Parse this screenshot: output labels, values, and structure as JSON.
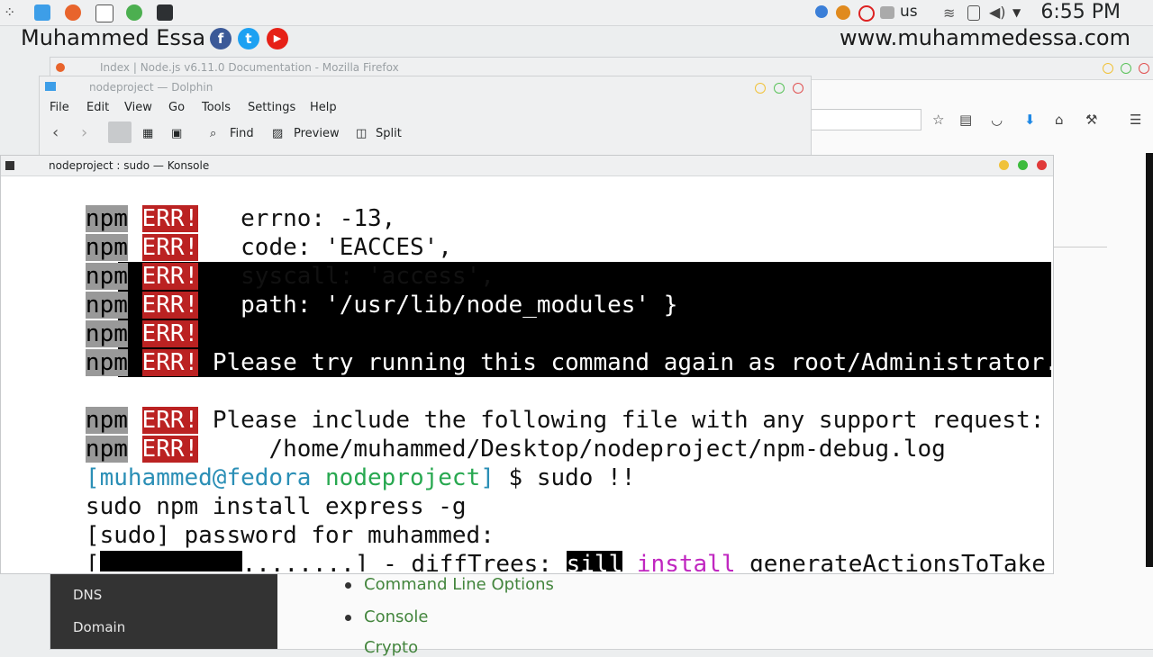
{
  "panel": {
    "keyboard_layout": "us",
    "clock": "6:55 PM",
    "colors": {
      "background": "#eff0f1"
    }
  },
  "watermark": {
    "name": "Muhammed Essa",
    "site": "www.muhammedessa.com",
    "social": [
      "f",
      "t",
      "▶"
    ]
  },
  "firefox": {
    "title": "Index | Node.js v6.11.0 Documentation - Mozilla Firefox",
    "sidebar_items": [
      "DNS",
      "Domain"
    ],
    "doc_links": [
      "Command Line Options",
      "Console",
      "Crypto"
    ]
  },
  "dolphin": {
    "title": "nodeproject — Dolphin",
    "menu": [
      "File",
      "Edit",
      "View",
      "Go",
      "Tools",
      "Settings",
      "Help"
    ],
    "toolbar": {
      "find": "Find",
      "preview": "Preview",
      "split": "Split"
    }
  },
  "konsole": {
    "title": "nodeproject : sudo — Konsole",
    "npm_tag": "npm",
    "err_tag": "ERR!",
    "err_lines": [
      "   errno: -13,",
      "   code: 'EACCES',",
      "   syscall: 'access',",
      "   path: '/usr/lib/node_modules' }",
      "",
      " Please try running this command again as root/Administrator.",
      "",
      " Please include the following file with any support request:",
      "     /home/muhammed/Desktop/nodeproject/npm-debug.log"
    ],
    "prompt": {
      "user_host": "[muhammed@fedora",
      "dir": "nodeproject",
      "bracket_close": "]",
      "symbol": "$",
      "command": "sudo !!"
    },
    "echo_command": "sudo npm install express -g",
    "sudo_prompt": "[sudo] password for muhammed:",
    "progress": {
      "open": "[",
      "remaining": "........",
      "close": "] - diffTrees:",
      "level": "sill",
      "action": "install",
      "detail": "generateActionsToTake",
      "fraction_complete": 0.6
    }
  }
}
